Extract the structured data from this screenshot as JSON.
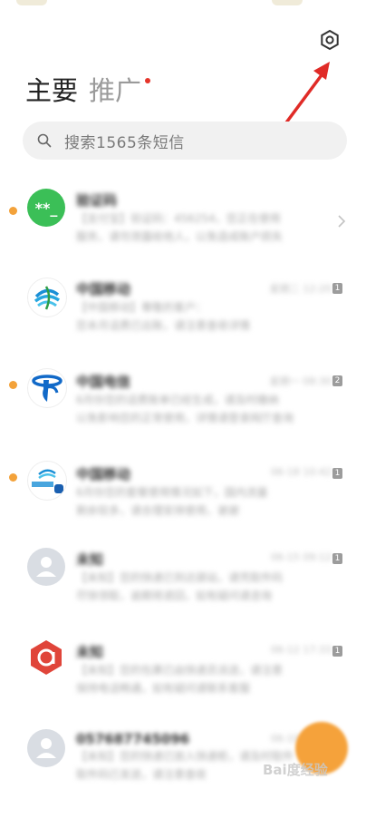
{
  "header": {
    "tabs": [
      {
        "label": "主要"
      },
      {
        "label": "推广"
      }
    ],
    "settings_icon": "settings-gear-icon"
  },
  "search": {
    "placeholder": "搜索1565条短信"
  },
  "conversations": [
    {
      "name": "验证码",
      "avatar_text": "**_",
      "avatar_type": "green",
      "unread": true,
      "badge": "",
      "time": "",
      "preview": [
        "【支付宝】验证码：456254，您正在使用",
        "服务，请勿泄露给他人，以免造成账户损失"
      ]
    },
    {
      "name": "中国移动",
      "avatar_type": "china-mobile",
      "unread": false,
      "badge": "1",
      "time": "星期二 12:20",
      "preview": [
        "【中国移动】尊敬的客户：",
        "您本月话费已出账，请注意查收详情"
      ]
    },
    {
      "name": "中国电信",
      "avatar_type": "china-telecom",
      "unread": true,
      "badge": "2",
      "time": "星期一 08:30",
      "preview": [
        "6月份您的话费账单已经生成，请及时缴纳",
        "以免影响您的正常使用，详情请登录网厅查询"
      ]
    },
    {
      "name": "中国移动",
      "avatar_type": "china-mobile-5g",
      "unread": true,
      "badge": "1",
      "time": "06-18 10:42",
      "preview": [
        "6月份您的套餐使用情况如下，国内流量",
        "剩余较多，请合理安排使用，谢谢"
      ]
    },
    {
      "name": "未知",
      "avatar_type": "grey",
      "unread": false,
      "badge": "1",
      "time": "06-15 09:12",
      "preview": [
        "【未知】您的快递已到达驿站，请凭取件码",
        "尽快领取，逾期将退回，如有疑问请咨询"
      ]
    },
    {
      "name": "未知",
      "avatar_type": "red-logo",
      "unread": false,
      "badge": "1",
      "time": "06-12 17:33",
      "preview": [
        "【未知】您的包裹已由快递员派送，请注意",
        "保持电话畅通，如有疑问请联系客服"
      ]
    },
    {
      "name": "057687745096",
      "avatar_type": "grey",
      "unread": false,
      "badge": "",
      "time": "06-10 11:05",
      "preview": [
        "【未知】您的快递已放入快递柜，请及时取件",
        "取件码已发送，请注意查收"
      ]
    }
  ],
  "watermark": "Bai度经验",
  "colors": {
    "unread_dot": "#f3a23a",
    "fab": "#f5a23b",
    "promo_dot": "#e5342a",
    "arrow": "#e02b27"
  }
}
